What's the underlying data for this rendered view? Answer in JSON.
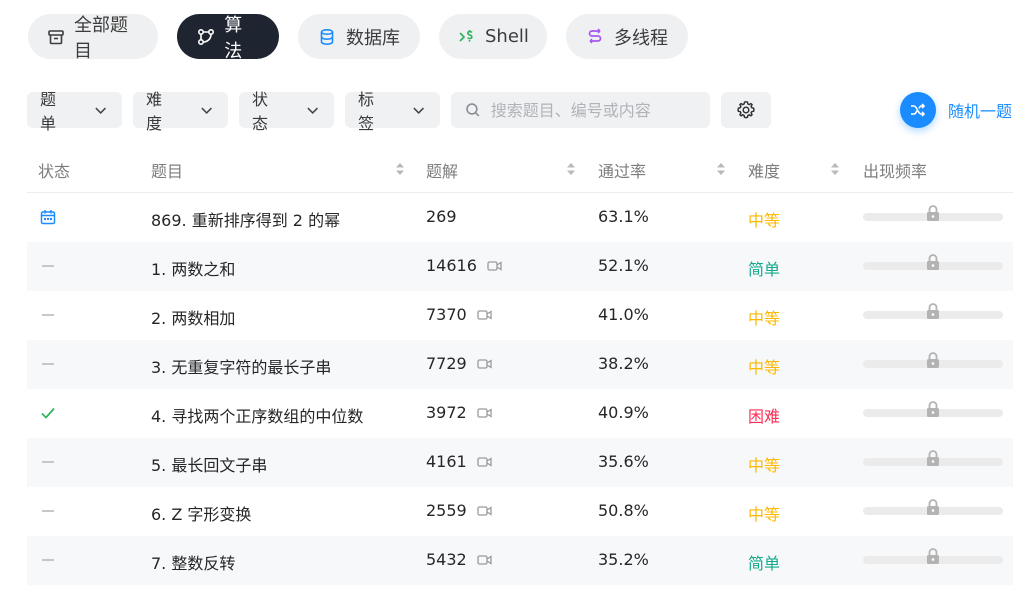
{
  "tabs": [
    {
      "label": "全部题目",
      "icon": "archive-icon",
      "active": false
    },
    {
      "label": "算法",
      "icon": "algorithm-icon",
      "active": true
    },
    {
      "label": "数据库",
      "icon": "database-icon",
      "active": false
    },
    {
      "label": "Shell",
      "icon": "shell-icon",
      "active": false
    },
    {
      "label": "多线程",
      "icon": "concurrency-icon",
      "active": false
    }
  ],
  "filters": {
    "list": "题单",
    "difficulty": "难度",
    "status": "状态",
    "tags": "标签"
  },
  "search": {
    "placeholder": "搜索题目、编号或内容"
  },
  "random_label": "随机一题",
  "table": {
    "headers": {
      "status": "状态",
      "title": "题目",
      "solutions": "题解",
      "acceptance": "通过率",
      "difficulty": "难度",
      "frequency": "出现频率"
    },
    "rows": [
      {
        "status": "daily",
        "title": "869. 重新排序得到 2 的幂",
        "solutions": "269",
        "video": false,
        "acceptance": "63.1%",
        "difficulty": "中等",
        "level": "mid"
      },
      {
        "status": "none",
        "title": "1. 两数之和",
        "solutions": "14616",
        "video": true,
        "acceptance": "52.1%",
        "difficulty": "简单",
        "level": "easy"
      },
      {
        "status": "none",
        "title": "2. 两数相加",
        "solutions": "7370",
        "video": true,
        "acceptance": "41.0%",
        "difficulty": "中等",
        "level": "mid"
      },
      {
        "status": "none",
        "title": "3. 无重复字符的最长子串",
        "solutions": "7729",
        "video": true,
        "acceptance": "38.2%",
        "difficulty": "中等",
        "level": "mid"
      },
      {
        "status": "solved",
        "title": "4. 寻找两个正序数组的中位数",
        "solutions": "3972",
        "video": true,
        "acceptance": "40.9%",
        "difficulty": "困难",
        "level": "hard"
      },
      {
        "status": "none",
        "title": "5. 最长回文子串",
        "solutions": "4161",
        "video": true,
        "acceptance": "35.6%",
        "difficulty": "中等",
        "level": "mid"
      },
      {
        "status": "none",
        "title": "6. Z 字形变换",
        "solutions": "2559",
        "video": true,
        "acceptance": "50.8%",
        "difficulty": "中等",
        "level": "mid"
      },
      {
        "status": "none",
        "title": "7. 整数反转",
        "solutions": "5432",
        "video": true,
        "acceptance": "35.2%",
        "difficulty": "简单",
        "level": "easy"
      }
    ]
  },
  "colors": {
    "accent": "#1a8cff",
    "easy": "#14a98b",
    "medium": "#ffb800",
    "hard": "#ff2d55",
    "solved": "#2db55d",
    "shell_green": "#2db55d",
    "concurrency_purple": "#a855f7"
  }
}
